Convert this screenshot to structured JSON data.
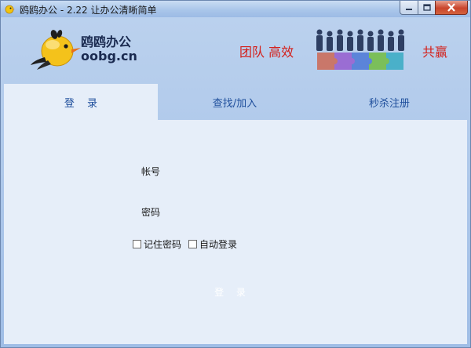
{
  "window": {
    "title": "鸥鸥办公 - 2.22 让办公清晰简单"
  },
  "banner": {
    "logo_cn": "鸥鸥办公",
    "logo_en": "oobg.cn",
    "slogan_left": "团队 高效",
    "slogan_right": "共赢"
  },
  "tabs": [
    {
      "label": "登 录",
      "active": true
    },
    {
      "label": "查找/加入",
      "active": false
    },
    {
      "label": "秒杀注册",
      "active": false
    }
  ],
  "form": {
    "account_label": "帐号",
    "password_label": "密码",
    "remember_label": "记住密码",
    "auto_login_label": "自动登录",
    "remember_checked": false,
    "auto_login_checked": false,
    "login_button": "登 录"
  },
  "colors": {
    "accent": "#1f4f9c",
    "slogan": "#d4201b",
    "panel": "#e6eef9"
  }
}
